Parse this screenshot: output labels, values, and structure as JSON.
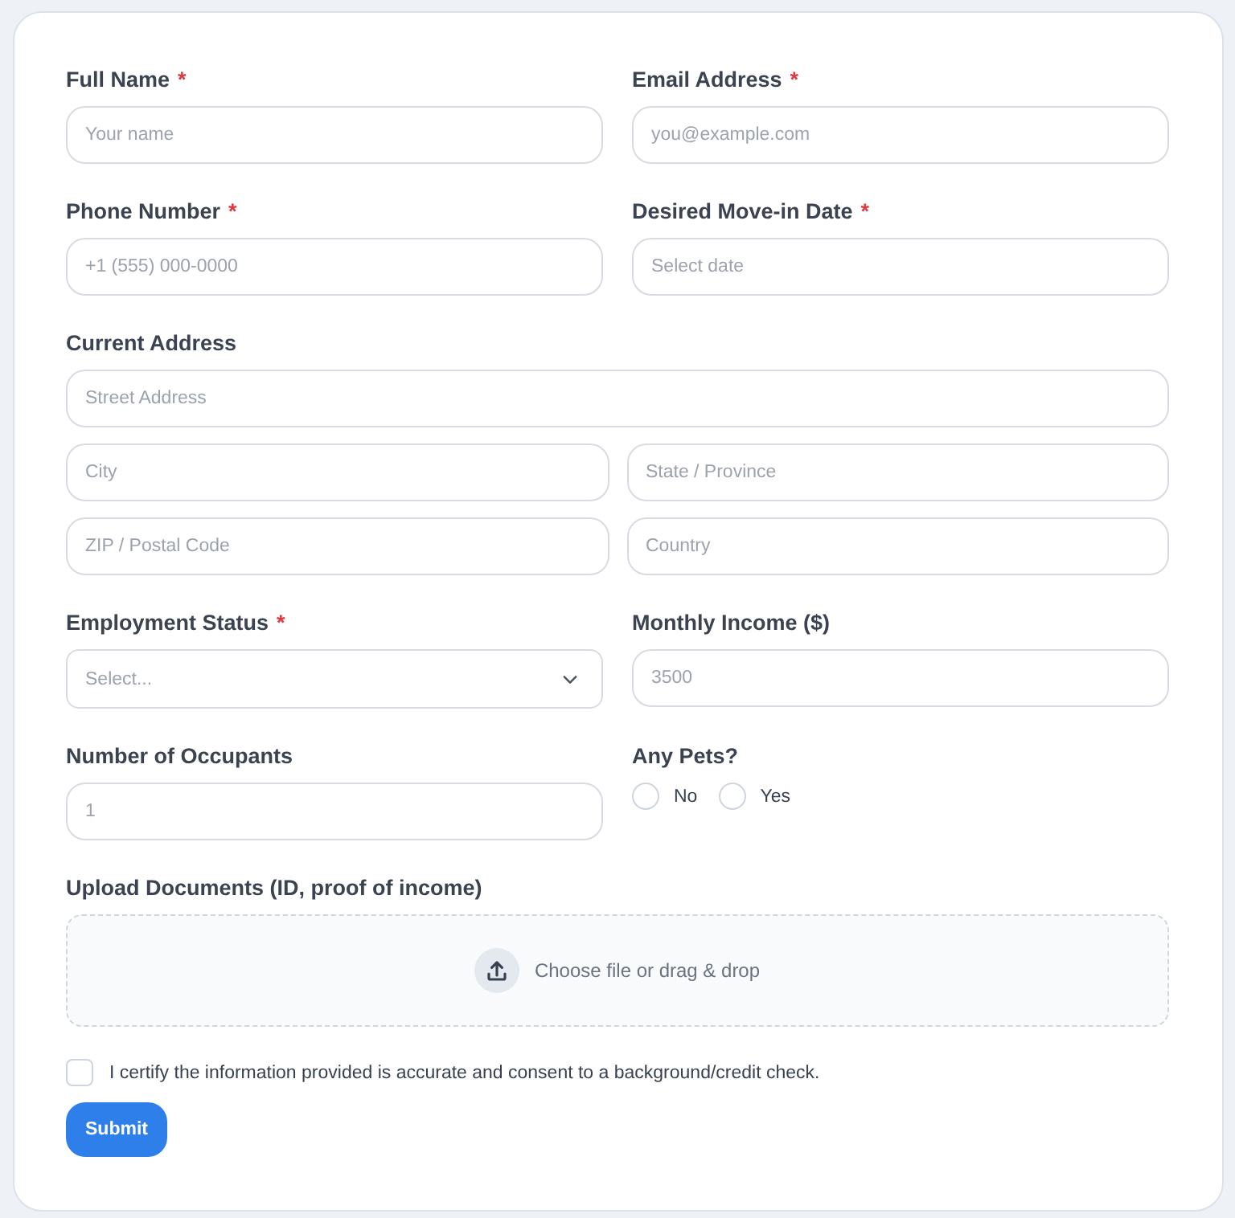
{
  "form": {
    "required_marker": "*",
    "fields": [
      {
        "kind": "input",
        "label": "Full Name",
        "required": true,
        "placeholder": "Your name"
      },
      {
        "kind": "input",
        "label": "Email Address",
        "required": true,
        "placeholder": "you@example.com"
      },
      {
        "kind": "input",
        "label": "Phone Number",
        "required": true,
        "placeholder": "+1 (555) 000-0000"
      },
      {
        "kind": "input",
        "label": "Desired Move-in Date",
        "required": true,
        "placeholder": "Select date"
      },
      {
        "kind": "address",
        "label": "Current Address",
        "required": false,
        "parts": [
          {
            "kind": "full",
            "placeholder": "Street Address"
          },
          {
            "kind": "half",
            "placeholder": "City"
          },
          {
            "kind": "half",
            "placeholder": "State / Province"
          },
          {
            "kind": "half",
            "placeholder": "ZIP / Postal Code"
          },
          {
            "kind": "half",
            "placeholder": "Country"
          }
        ]
      },
      {
        "kind": "select",
        "label": "Employment Status",
        "required": true,
        "placeholder": "Select..."
      },
      {
        "kind": "input",
        "label": "Monthly Income ($)",
        "required": false,
        "placeholder": "3500"
      },
      {
        "kind": "input",
        "label": "Number of Occupants",
        "required": false,
        "placeholder": "1"
      },
      {
        "kind": "radio",
        "label": "Any Pets?",
        "required": false,
        "options": [
          {
            "label": "No",
            "selected": false
          },
          {
            "label": "Yes",
            "selected": false
          }
        ]
      },
      {
        "kind": "upload",
        "label": "Upload Documents (ID, proof of income)",
        "required": false,
        "prompt": "Choose file or drag & drop"
      }
    ],
    "consent": {
      "checked": false,
      "text": "I certify the information provided is accurate and consent to a background/credit check."
    },
    "submit": {
      "label": "Submit"
    }
  }
}
